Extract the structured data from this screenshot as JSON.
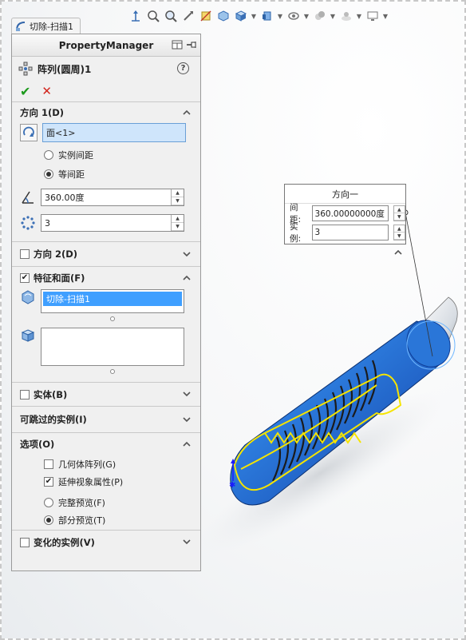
{
  "document_tab": {
    "label": "切除-扫描1"
  },
  "property_manager": {
    "header": "PropertyManager",
    "feature_title": "阵列(圆周)1",
    "help": "?",
    "ok_label": "✔",
    "cancel_label": "✕",
    "direction1": {
      "title": "方向 1(D)",
      "axis_value": "面<1>",
      "radio_instance_spacing": "实例间距",
      "radio_equal_spacing": "等间距",
      "angle_value": "360.00度",
      "count_value": "3"
    },
    "direction2": {
      "title": "方向 2(D)"
    },
    "features_faces": {
      "title": "特征和面(F)",
      "items": [
        "切除-扫描1"
      ]
    },
    "bodies": {
      "title": "实体(B)"
    },
    "skip_instances": {
      "title": "可跳过的实例(I)"
    },
    "options": {
      "title": "选项(O)",
      "geometry_pattern": "几何体阵列(G)",
      "propagate_visual": "延伸视象属性(P)",
      "full_preview": "完整预览(F)",
      "partial_preview": "部分预览(T)"
    },
    "varied_instances": {
      "title": "变化的实例(V)"
    }
  },
  "callout": {
    "title": "方向一",
    "spacing_label": "间距:",
    "spacing_value": "360.00000000度",
    "instances_label": "实例:",
    "instances_value": "3"
  },
  "colors": {
    "selection": "#3f9fff",
    "part_blue": "#2e7fe0",
    "sketch_yellow": "#f5e400"
  }
}
